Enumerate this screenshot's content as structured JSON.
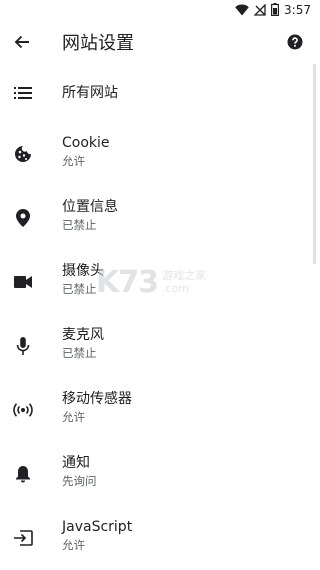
{
  "status_bar": {
    "time": "3:57",
    "icons": [
      "wifi-icon",
      "signal-off-icon",
      "battery-icon"
    ]
  },
  "app_bar": {
    "back_icon": "arrow-back-icon",
    "title": "网站设置",
    "help_icon": "help-icon"
  },
  "settings": {
    "items": [
      {
        "icon": "list-icon",
        "label": "所有网站",
        "sub": ""
      },
      {
        "icon": "cookie-icon",
        "label": "Cookie",
        "sub": "允许"
      },
      {
        "icon": "location-pin-icon",
        "label": "位置信息",
        "sub": "已禁止"
      },
      {
        "icon": "camera-icon",
        "label": "摄像头",
        "sub": "已禁止"
      },
      {
        "icon": "microphone-icon",
        "label": "麦克风",
        "sub": "已禁止"
      },
      {
        "icon": "motion-sensor-icon",
        "label": "移动传感器",
        "sub": "允许"
      },
      {
        "icon": "notification-bell-icon",
        "label": "通知",
        "sub": "先询问"
      },
      {
        "icon": "javascript-icon",
        "label": "JavaScript",
        "sub": "允许"
      }
    ]
  },
  "watermark": {
    "logo": "K73",
    "cn": "游戏之家",
    "com": ".com"
  },
  "colors": {
    "text_primary": "#202124",
    "text_secondary": "#5f6368",
    "icon": "#202124",
    "background": "#ffffff"
  }
}
